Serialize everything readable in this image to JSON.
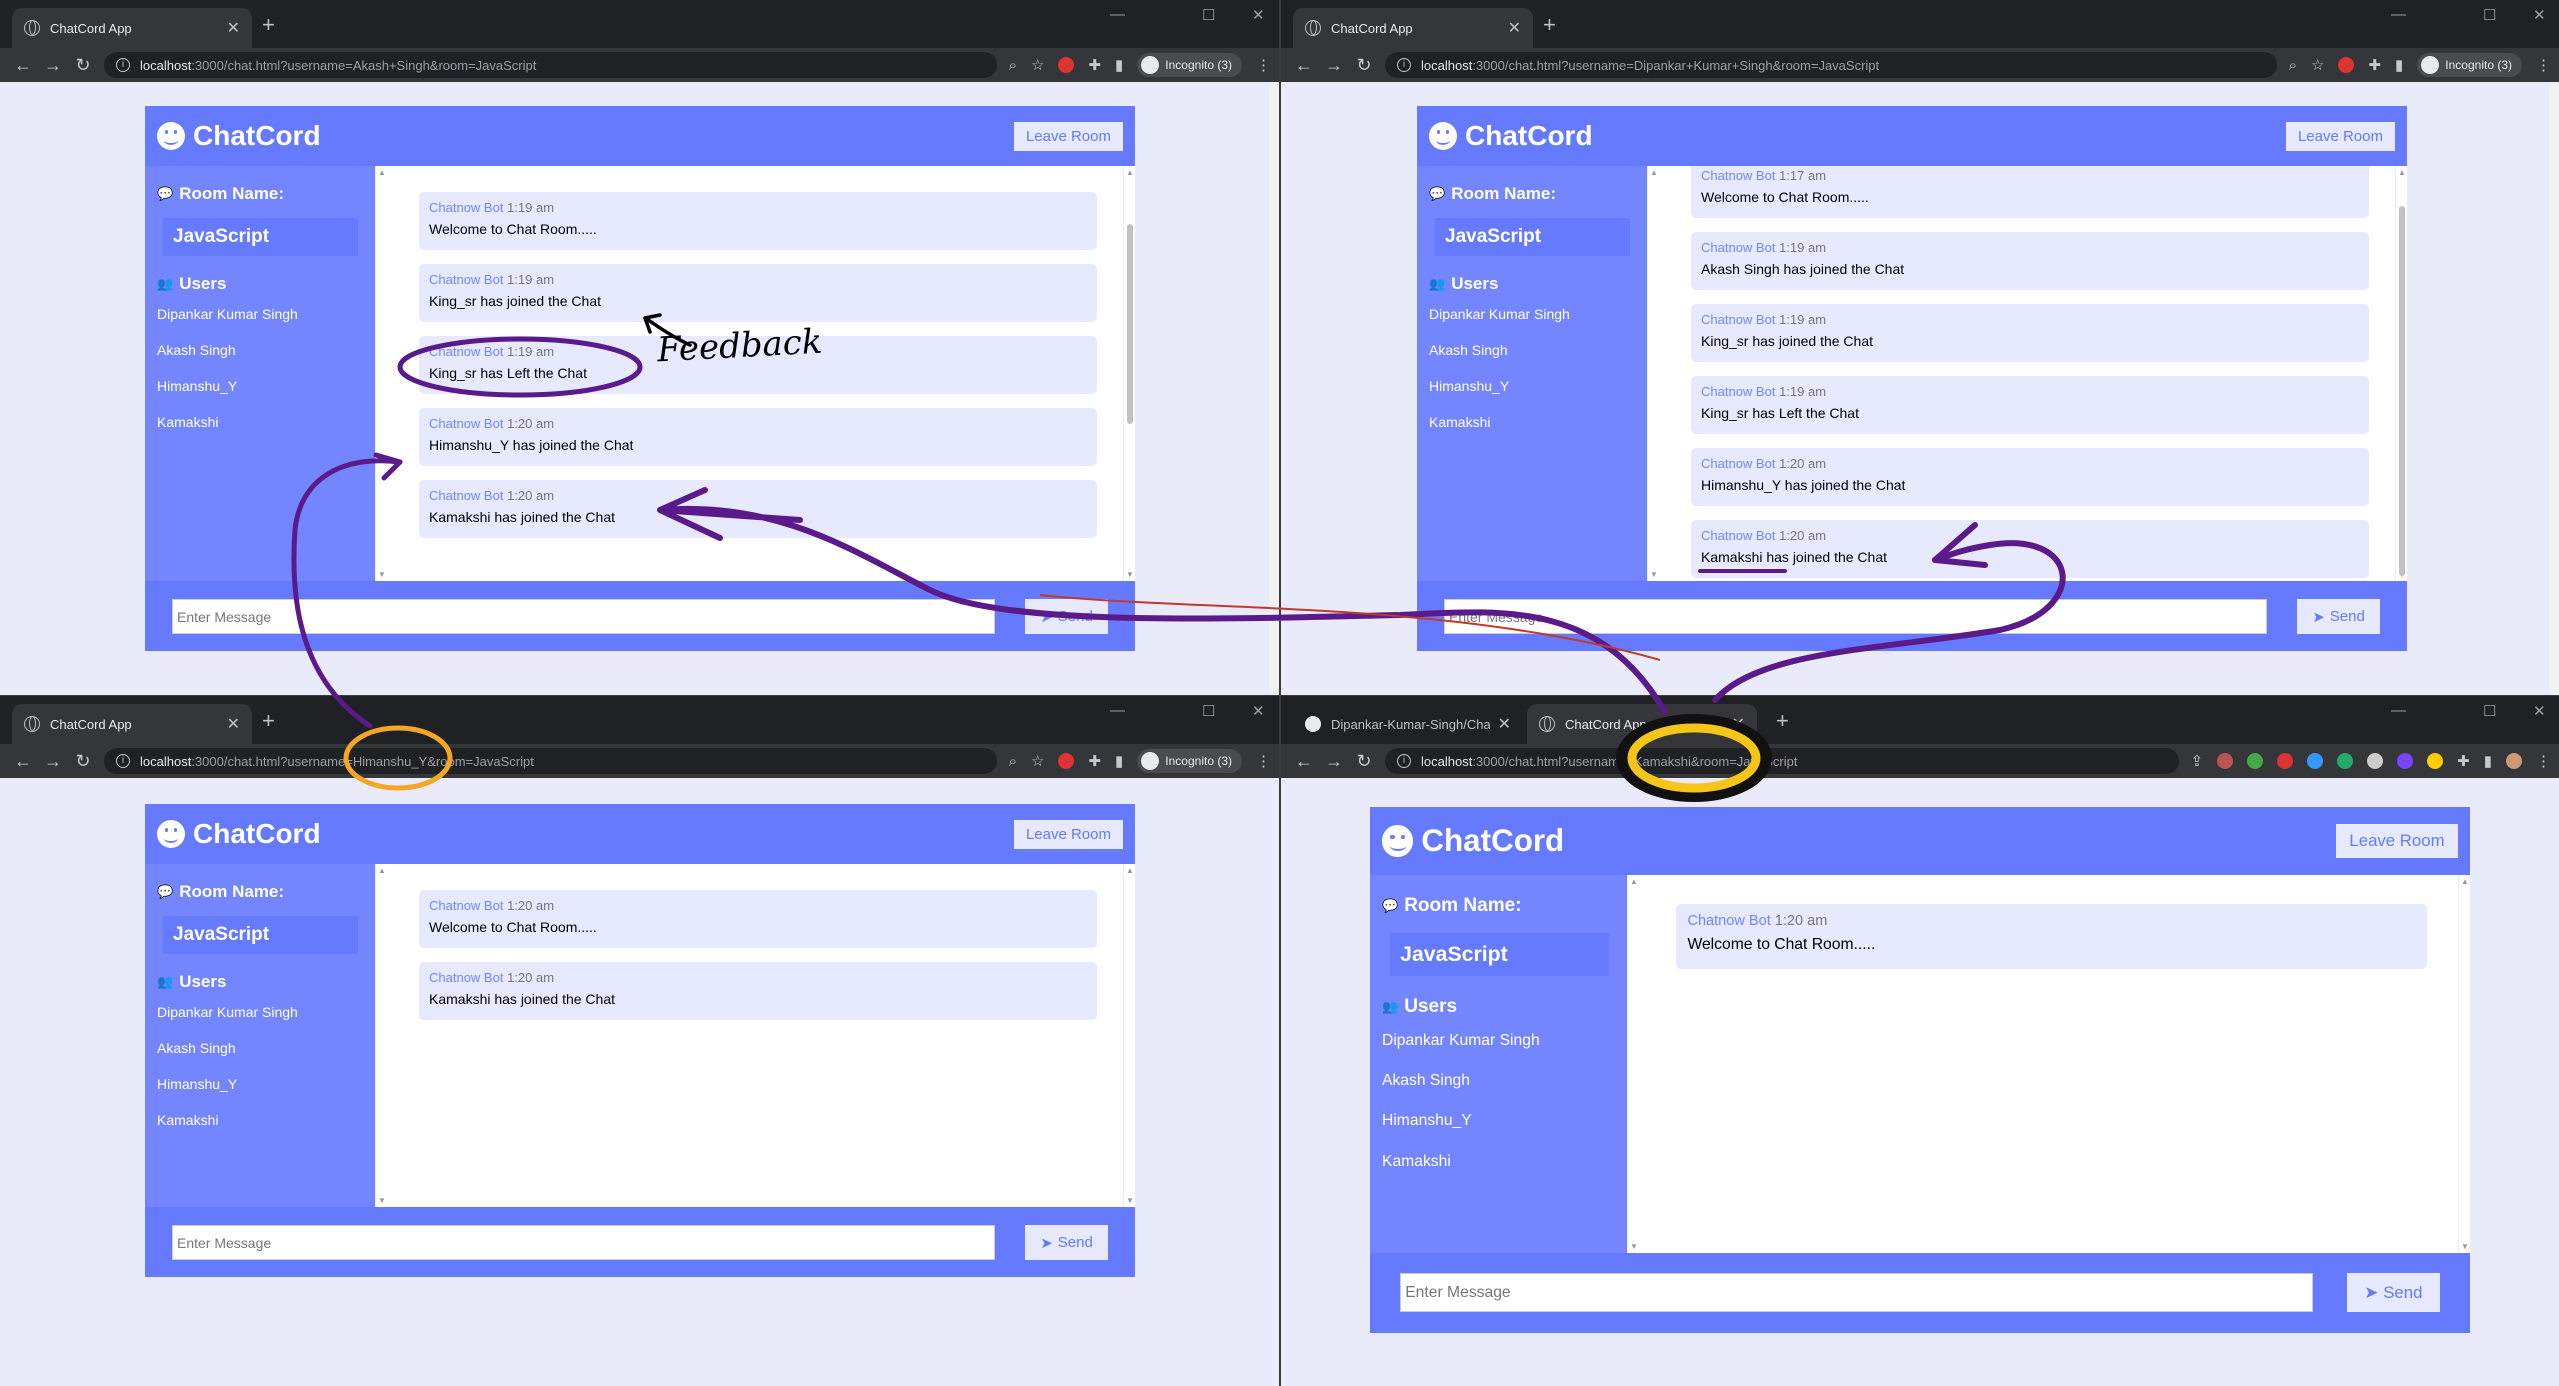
{
  "colors": {
    "primary": "#667aff",
    "secondary": "#7386ff",
    "light": "#e6e9ff",
    "background": "#e9ebfb",
    "annotation_purple": "#5a1a8a",
    "annotation_orange": "#f5a623",
    "annotation_yellow": "#f5c518"
  },
  "windows": [
    {
      "tabs": [
        {
          "title": "ChatCord App",
          "icon": "globe-icon"
        }
      ],
      "url": {
        "host": "localhost",
        "rest": ":3000/chat.html?username=Akash+Singh&room=JavaScript"
      },
      "incognito_label": "Incognito (3)",
      "app": {
        "brand": "ChatCord",
        "leave_label": "Leave Room",
        "room_heading": "Room Name:",
        "room_name": "JavaScript",
        "users_heading": "Users",
        "users": [
          "Dipankar Kumar Singh",
          "Akash Singh",
          "Himanshu_Y",
          "Kamakshi"
        ],
        "messages": [
          {
            "user": "Chatnow Bot",
            "time": "1:19 am",
            "text": "Welcome to Chat Room....."
          },
          {
            "user": "Chatnow Bot",
            "time": "1:19 am",
            "text": "King_sr has joined the Chat"
          },
          {
            "user": "Chatnow Bot",
            "time": "1:19 am",
            "text": "King_sr has Left the Chat"
          },
          {
            "user": "Chatnow Bot",
            "time": "1:20 am",
            "text": "Himanshu_Y has joined the Chat"
          },
          {
            "user": "Chatnow Bot",
            "time": "1:20 am",
            "text": "Kamakshi has joined the Chat"
          }
        ],
        "placeholder": "Enter Message",
        "send_label": "Send"
      }
    },
    {
      "tabs": [
        {
          "title": "ChatCord App",
          "icon": "globe-icon"
        }
      ],
      "url": {
        "host": "localhost",
        "rest": ":3000/chat.html?username=Dipankar+Kumar+Singh&room=JavaScript"
      },
      "incognito_label": "Incognito (3)",
      "app": {
        "brand": "ChatCord",
        "leave_label": "Leave Room",
        "room_heading": "Room Name:",
        "room_name": "JavaScript",
        "users_heading": "Users",
        "users": [
          "Dipankar Kumar Singh",
          "Akash Singh",
          "Himanshu_Y",
          "Kamakshi"
        ],
        "messages": [
          {
            "user": "Chatnow Bot",
            "time": "1:17 am",
            "text": "Welcome to Chat Room....."
          },
          {
            "user": "Chatnow Bot",
            "time": "1:19 am",
            "text": "Akash Singh has joined the Chat"
          },
          {
            "user": "Chatnow Bot",
            "time": "1:19 am",
            "text": "King_sr has joined the Chat"
          },
          {
            "user": "Chatnow Bot",
            "time": "1:19 am",
            "text": "King_sr has Left the Chat"
          },
          {
            "user": "Chatnow Bot",
            "time": "1:20 am",
            "text": "Himanshu_Y has joined the Chat"
          },
          {
            "user": "Chatnow Bot",
            "time": "1:20 am",
            "text": "Kamakshi has joined the Chat"
          }
        ],
        "placeholder": "Enter Message",
        "send_label": "Send"
      }
    },
    {
      "tabs": [
        {
          "title": "ChatCord App",
          "icon": "globe-icon"
        }
      ],
      "url": {
        "host": "localhost",
        "rest": ":3000/chat.html?username=Himanshu_Y&room=JavaScript"
      },
      "incognito_label": "Incognito (3)",
      "app": {
        "brand": "ChatCord",
        "leave_label": "Leave Room",
        "room_heading": "Room Name:",
        "room_name": "JavaScript",
        "users_heading": "Users",
        "users": [
          "Dipankar Kumar Singh",
          "Akash Singh",
          "Himanshu_Y",
          "Kamakshi"
        ],
        "messages": [
          {
            "user": "Chatnow Bot",
            "time": "1:20 am",
            "text": "Welcome to Chat Room....."
          },
          {
            "user": "Chatnow Bot",
            "time": "1:20 am",
            "text": "Kamakshi has joined the Chat"
          }
        ],
        "placeholder": "Enter Message",
        "send_label": "Send"
      }
    },
    {
      "tabs": [
        {
          "title": "Dipankar-Kumar-Singh/Chatnow",
          "icon": "github-icon"
        },
        {
          "title": "ChatCord App",
          "icon": "globe-icon"
        }
      ],
      "url": {
        "host": "localhost",
        "rest": ":3000/chat.html?username=Kamakshi&room=JavaScript"
      },
      "incognito_label": "",
      "app": {
        "brand": "ChatCord",
        "leave_label": "Leave Room",
        "room_heading": "Room Name:",
        "room_name": "JavaScript",
        "users_heading": "Users",
        "users": [
          "Dipankar Kumar Singh",
          "Akash Singh",
          "Himanshu_Y",
          "Kamakshi"
        ],
        "messages": [
          {
            "user": "Chatnow Bot",
            "time": "1:20 am",
            "text": "Welcome to Chat Room....."
          }
        ],
        "placeholder": "Enter Message",
        "send_label": "Send"
      }
    }
  ],
  "annotations": {
    "feedback_label": "Feedback"
  }
}
